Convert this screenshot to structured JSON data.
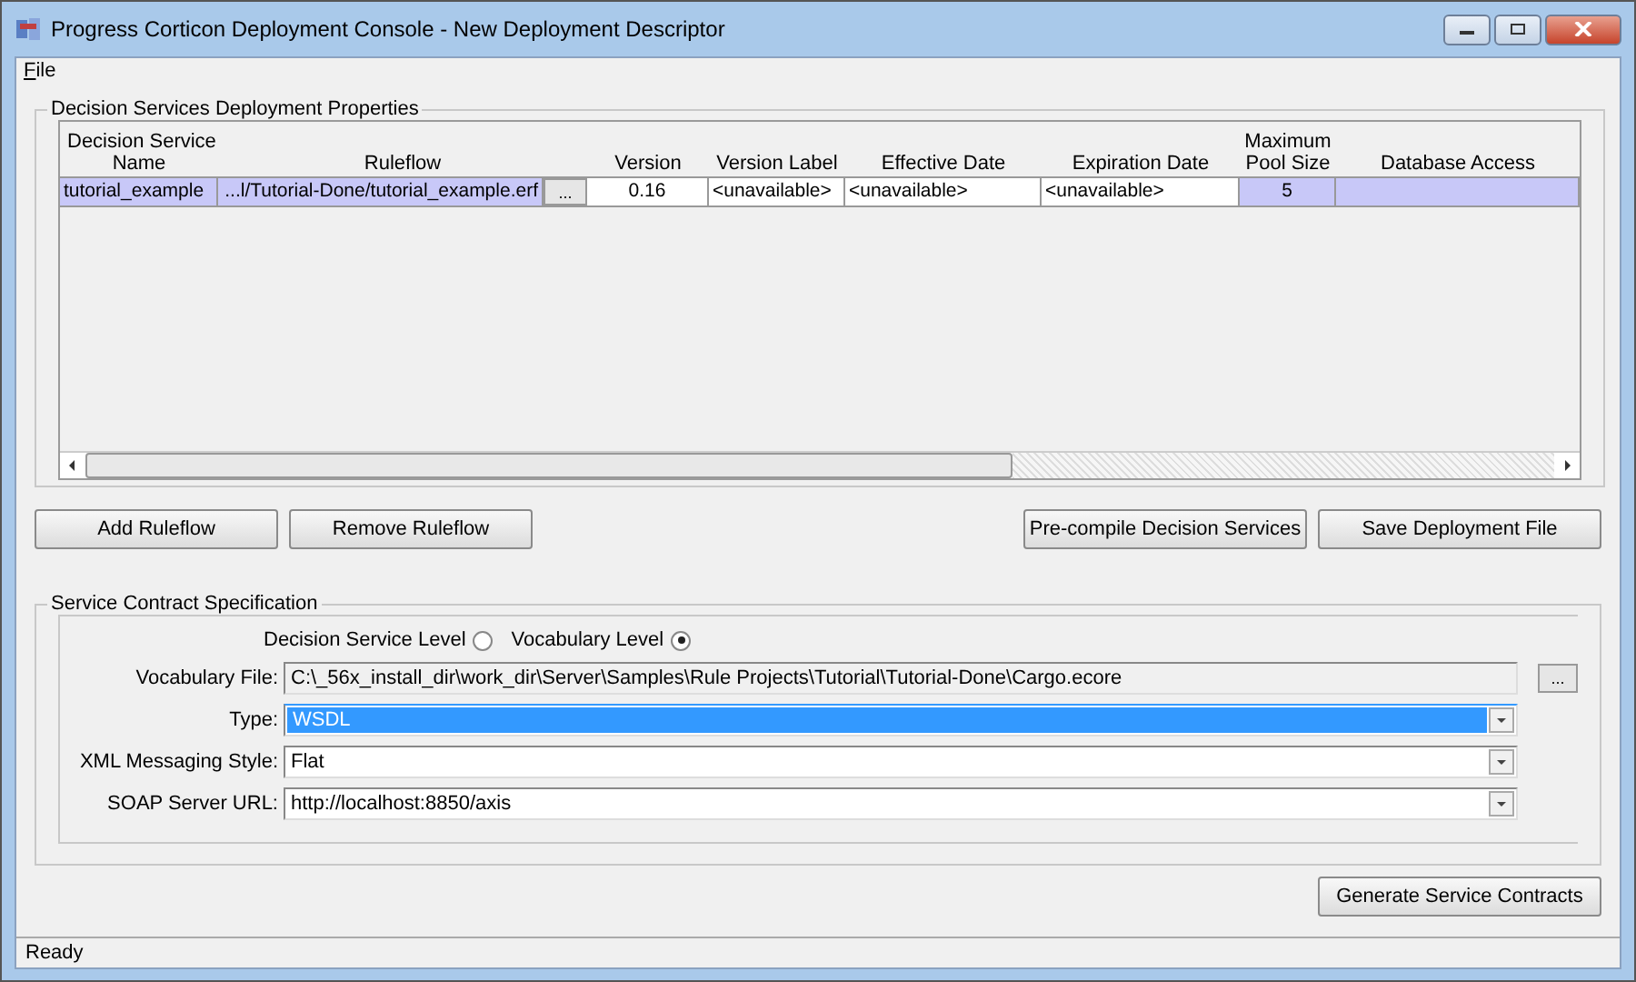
{
  "window": {
    "title": "Progress Corticon Deployment Console - New Deployment Descriptor"
  },
  "menu": [
    {
      "label": "File"
    }
  ],
  "deployment_group": {
    "title": "Decision Services Deployment Properties",
    "table": {
      "columns": [
        {
          "line1": "Decision Service",
          "line2": "Name"
        },
        {
          "line2": "Ruleflow"
        },
        {
          "line2": "Version"
        },
        {
          "line2": "Version Label"
        },
        {
          "line2": "Effective Date"
        },
        {
          "line2": "Expiration Date"
        },
        {
          "line1": "Maximum",
          "line2": "Pool Size"
        },
        {
          "line2": "Database Access"
        }
      ],
      "rows": [
        {
          "selected": true,
          "cells": [
            {
              "text": "tutorial_example",
              "highlighted": true
            },
            {
              "text": "...l/Tutorial-Done/tutorial_example.erf",
              "highlighted": true,
              "browse": "..."
            },
            {
              "text": "0.16",
              "highlighted": false
            },
            {
              "text": "<unavailable>",
              "highlighted": false
            },
            {
              "text": "<unavailable>",
              "highlighted": false
            },
            {
              "text": "<unavailable>",
              "highlighted": false
            },
            {
              "text": "5",
              "highlighted": true
            },
            {
              "text": "",
              "highlighted": true
            }
          ]
        }
      ]
    }
  },
  "left_buttons": [
    "Add Ruleflow",
    "Remove Ruleflow"
  ],
  "right_buttons": [
    "Pre-compile Decision Services",
    "Save Deployment File"
  ],
  "contract_group": {
    "title": "Service Contract Specification",
    "radios": [
      {
        "label": "Decision Service Level",
        "selected": false
      },
      {
        "label": "Vocabulary Level",
        "selected": true
      }
    ],
    "fields": [
      {
        "label": "Vocabulary File:",
        "value": "C:\\_56x_install_dir\\work_dir\\Server\\Samples\\Rule Projects\\Tutorial\\Tutorial-Done\\Cargo.ecore",
        "kind": "file",
        "text_selected": false,
        "browse": "..."
      },
      {
        "label": "Type:",
        "value": "WSDL",
        "kind": "dropdown",
        "text_selected": true
      },
      {
        "label": "XML Messaging Style:",
        "value": "Flat",
        "kind": "dropdown",
        "text_selected": false
      },
      {
        "label": "SOAP Server URL:",
        "value": "http://localhost:8850/axis",
        "kind": "dropdown",
        "text_selected": false
      }
    ]
  },
  "generate_button": "Generate Service Contracts",
  "status_bar": "Ready"
}
